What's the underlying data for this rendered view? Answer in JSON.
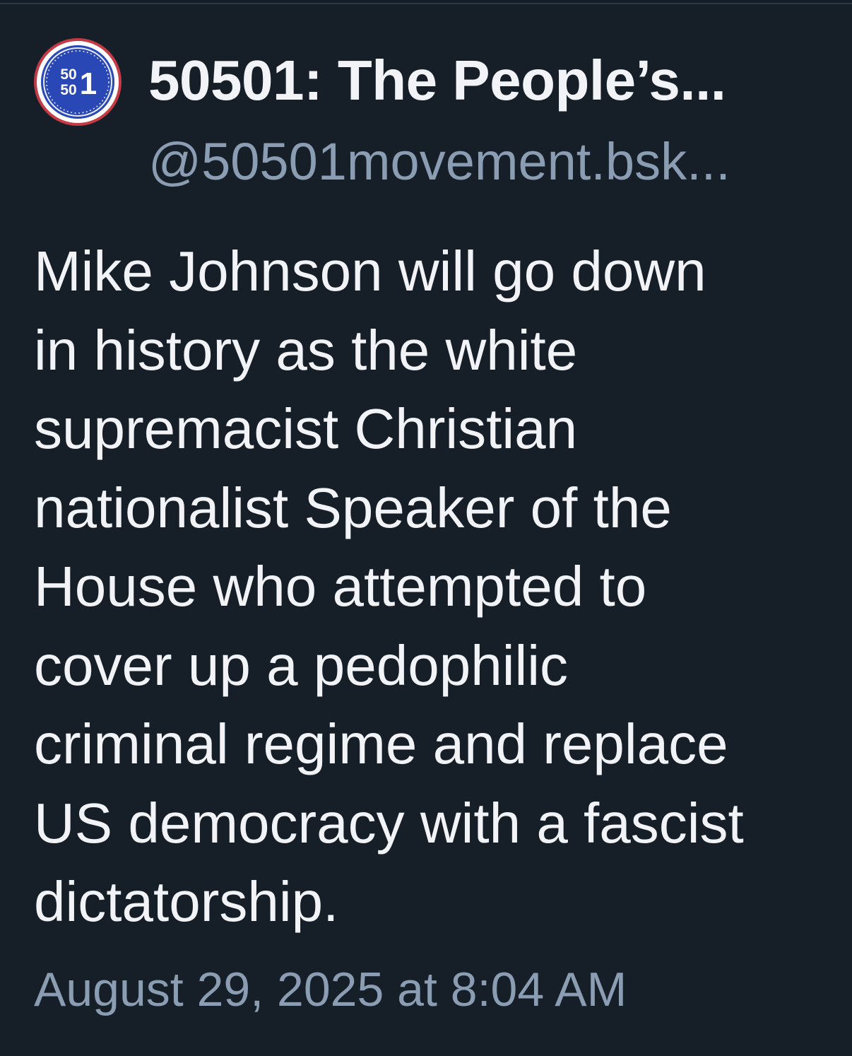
{
  "post": {
    "display_name": "50501: The People’s...",
    "handle": "@50501movement.bsk...",
    "avatar": {
      "logo_line1": "50",
      "logo_line2": "50",
      "logo_big": "1",
      "colors": {
        "ring": "#c43b46",
        "fill": "#2a47b6",
        "text": "#ffffff"
      }
    },
    "body_lines": [
      "Mike Johnson will go down",
      "in history as the white",
      "supremacist Christian",
      "nationalist Speaker of the",
      "House who attempted to",
      "cover up a pedophilic",
      "criminal regime and replace",
      "US democracy with a fascist",
      "dictatorship."
    ],
    "timestamp": "August 29, 2025 at 8:04 AM"
  },
  "theme": {
    "background": "#161e27",
    "text_primary": "#f1f3f6",
    "text_secondary": "#8b9db3"
  }
}
